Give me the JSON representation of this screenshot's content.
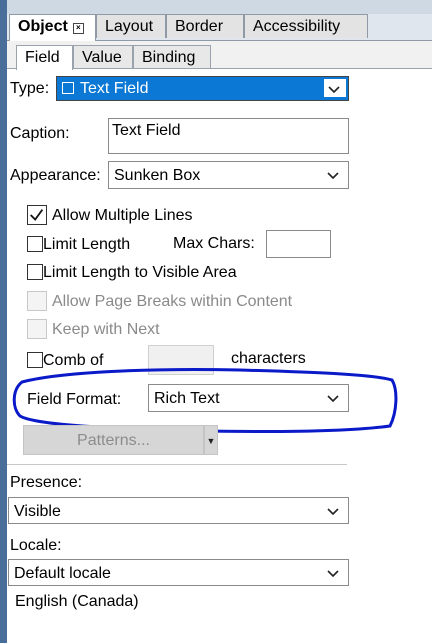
{
  "tabs": [
    {
      "label": "Object",
      "active": true,
      "closable": true
    },
    {
      "label": "Layout"
    },
    {
      "label": "Border"
    },
    {
      "label": "Accessibility"
    }
  ],
  "subtabs": [
    {
      "label": "Field",
      "active": true
    },
    {
      "label": "Value"
    },
    {
      "label": "Binding"
    }
  ],
  "type": {
    "label": "Type:",
    "value": "Text Field"
  },
  "caption": {
    "label": "Caption:",
    "value": "Text Field"
  },
  "appearance": {
    "label": "Appearance:",
    "value": "Sunken Box"
  },
  "options": {
    "allow_multiple_lines": {
      "label": "Allow Multiple Lines",
      "checked": true
    },
    "limit_length": {
      "label": "Limit Length",
      "checked": false
    },
    "max_chars_label": "Max Chars:",
    "max_chars_value": "",
    "limit_visible": {
      "label": "Limit Length to Visible Area",
      "checked": false
    },
    "allow_page_breaks": {
      "label": "Allow Page Breaks within Content",
      "enabled": false
    },
    "keep_with_next": {
      "label": "Keep with Next",
      "enabled": false
    },
    "comb_of": {
      "label": "Comb of",
      "checked": false
    },
    "comb_value": "",
    "characters_label": "characters"
  },
  "field_format": {
    "label": "Field Format:",
    "value": "Rich Text"
  },
  "patterns_button": "Patterns...",
  "presence": {
    "label": "Presence:",
    "value": "Visible"
  },
  "locale": {
    "label": "Locale:",
    "value": "Default locale",
    "resolved": "English (Canada)"
  },
  "colors": {
    "accent": "#0a78d4",
    "annotation": "#0a1ac8"
  },
  "icons": {
    "dropdown": "chevron-down-icon",
    "close": "close-icon",
    "check": "check-icon",
    "field_type": "text-field-icon"
  }
}
